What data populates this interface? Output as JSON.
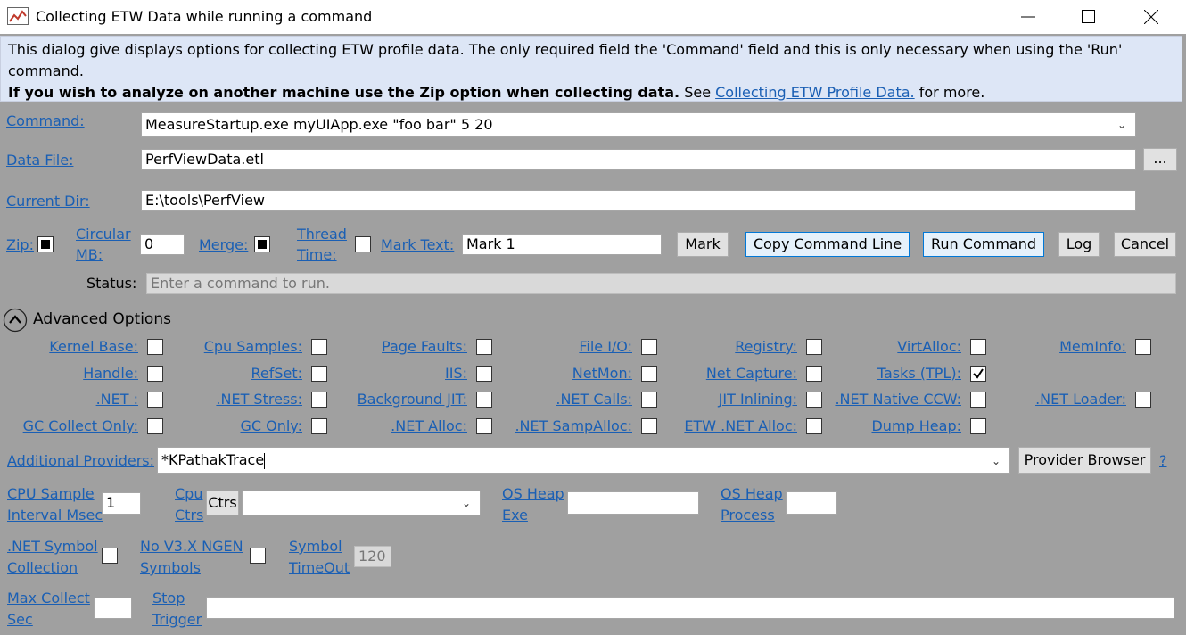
{
  "window": {
    "title": "Collecting ETW Data while running a command",
    "controls": [
      "minimize-icon",
      "maximize-icon",
      "close-icon"
    ]
  },
  "info": {
    "line1": "This dialog give displays options for collecting ETW profile data. The only required field the 'Command' field and this is only necessary when using the 'Run' command.",
    "bold": "If you wish to analyze on another machine use the Zip option when collecting data.",
    "see": " See ",
    "link": "Collecting ETW Profile Data.",
    "tail": " for more."
  },
  "command": {
    "label": "Command:",
    "value": "MeasureStartup.exe myUIApp.exe \"foo bar\" 5 20"
  },
  "data_file": {
    "label": "Data File:",
    "value": "PerfViewData.etl",
    "browse": "..."
  },
  "current_dir": {
    "label": "Current Dir:",
    "value": "E:\\tools\\PerfView"
  },
  "options_row": {
    "zip_label": "Zip:",
    "circular_label_1": "Circular",
    "circular_label_2": "MB:",
    "circular_value": "0",
    "merge_label": "Merge:",
    "thread_label_1": "Thread",
    "thread_label_2": "Time:",
    "mark_text_label": "Mark Text:",
    "mark_text_value": "Mark 1",
    "mark_button": "Mark",
    "copy_button": "Copy Command Line",
    "run_button": "Run Command",
    "log_button": "Log",
    "cancel_button": "Cancel"
  },
  "status": {
    "label": "Status:",
    "placeholder": "Enter a command to run."
  },
  "advanced": {
    "title": "Advanced Options",
    "rows": [
      [
        "Kernel Base:",
        "Cpu Samples:",
        "Page Faults:",
        "File I/O:",
        "Registry:",
        "VirtAlloc:",
        "MemInfo:"
      ],
      [
        "Handle:",
        "RefSet:",
        "IIS:",
        "NetMon:",
        "Net Capture:",
        "Tasks (TPL):"
      ],
      [
        ".NET :",
        ".NET Stress:",
        "Background JIT:",
        ".NET Calls:",
        "JIT Inlining:",
        ".NET Native CCW:",
        ".NET Loader:"
      ],
      [
        "GC Collect Only:",
        "GC Only:",
        ".NET Alloc:",
        ".NET SampAlloc:",
        "ETW .NET Alloc:",
        "Dump Heap:"
      ]
    ],
    "checked": [
      "Tasks (TPL):"
    ]
  },
  "providers": {
    "label": "Additional Providers:",
    "value": "*KPathakTrace",
    "browser_button": "Provider Browser",
    "help": "?"
  },
  "cpu_row": {
    "interval_1": "CPU Sample",
    "interval_2": "Interval Msec",
    "interval_value": "1",
    "ctrs_1": "Cpu",
    "ctrs_2": "Ctrs",
    "ctrs_button": "Ctrs",
    "heap_exe_1": "OS Heap",
    "heap_exe_2": "Exe",
    "heap_proc_1": "OS Heap",
    "heap_proc_2": "Process"
  },
  "symbol_row": {
    "net_sym_1": ".NET Symbol",
    "net_sym_2": "Collection",
    "nongen_1": "No V3.X NGEN",
    "nongen_2": "Symbols",
    "timeout_1": "Symbol",
    "timeout_2": "TimeOut",
    "timeout_value": "120"
  },
  "bottom_row": {
    "max_1": "Max Collect",
    "max_2": "Sec",
    "stop_1": "Stop",
    "stop_2": "Trigger"
  }
}
